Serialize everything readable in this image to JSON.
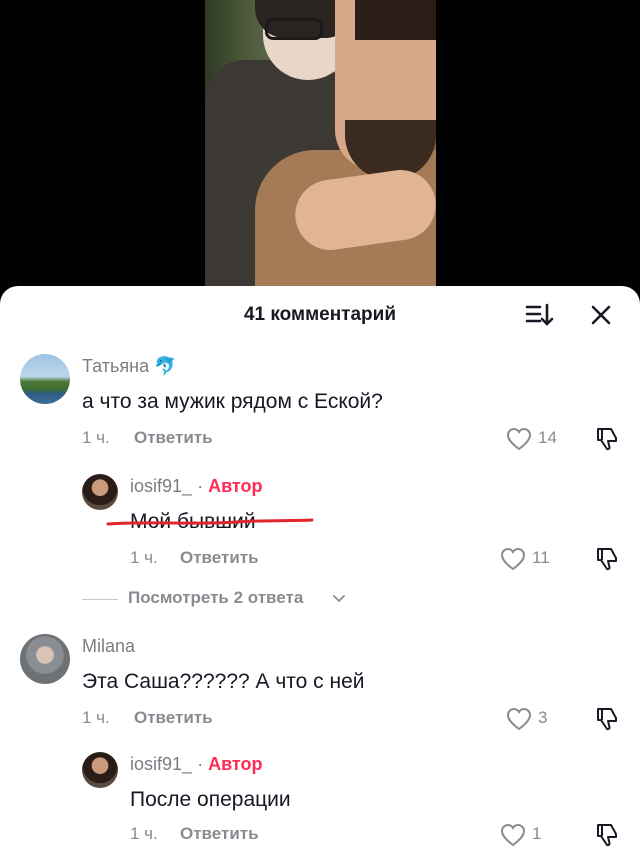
{
  "header": {
    "title": "41 комментарий"
  },
  "comments": [
    {
      "username": "Татьяна",
      "emoji": "🐬",
      "text": "а что за мужик рядом с Еской?",
      "time": "1 ч.",
      "reply_label": "Ответить",
      "likes": "14"
    },
    {
      "username": "iosif91_",
      "separator": "·",
      "author_label": "Автор",
      "text": "Мой бывший",
      "time": "1 ч.",
      "reply_label": "Ответить",
      "likes": "11"
    },
    {
      "username": "Milana",
      "text": "Эта Саша?????? А что с ней",
      "time": "1 ч.",
      "reply_label": "Ответить",
      "likes": "3"
    },
    {
      "username": "iosif91_",
      "separator": "·",
      "author_label": "Автор",
      "text": "После операции",
      "time": "1 ч.",
      "reply_label": "Ответить",
      "likes": "1"
    }
  ],
  "view_replies": {
    "label": "Посмотреть 2 ответа"
  },
  "colors": {
    "author": "#fe2c55",
    "underline": "#e0262c",
    "text": "#161823",
    "secondary": "#8a8b91"
  }
}
